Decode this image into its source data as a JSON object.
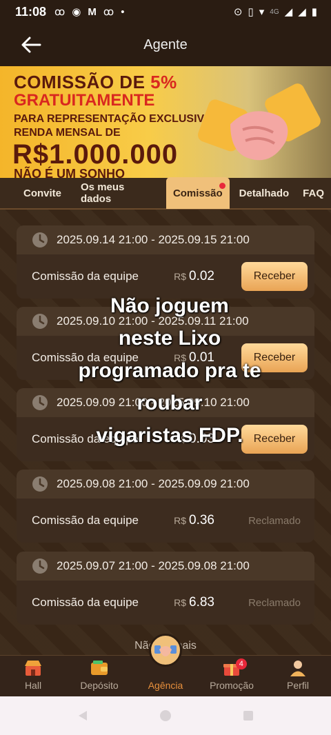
{
  "status_bar": {
    "time": "11:08",
    "notif_icons": [
      "sync-icon",
      "location-pin-icon",
      "gmail-icon",
      "sync-icon",
      "dot-icon"
    ],
    "network": "4G"
  },
  "header": {
    "title": "Agente"
  },
  "banner": {
    "line1_prefix": "COMISSÃO DE ",
    "line1_pct": "5%",
    "line2": "GRATUITAMENTE",
    "line3": "PARA REPRESENTAÇÃO EXCLUSIVA",
    "line4": "RENDA MENSAL DE",
    "line5": "R$1.000.000",
    "line6": "NÃO É UM SONHO"
  },
  "tabs": [
    {
      "label": "Convite",
      "active": false
    },
    {
      "label": "Os meus dados",
      "active": false
    },
    {
      "label": "Comissão",
      "active": true,
      "dot": true
    },
    {
      "label": "Detalhado",
      "active": false
    },
    {
      "label": "FAQ",
      "active": false
    }
  ],
  "records": [
    {
      "period": "2025.09.14 21:00 - 2025.09.15 21:00",
      "label": "Comissão da equipe",
      "currency": "R$",
      "amount": "0.02",
      "action": "Receber",
      "claimed": false
    },
    {
      "period": "2025.09.10 21:00 - 2025.09.11 21:00",
      "label": "Comissão da equipe",
      "currency": "R$",
      "amount": "0.01",
      "action": "Receber",
      "claimed": false
    },
    {
      "period": "2025.09.09 21:00 - 2025.09.10 21:00",
      "label": "Comissão da equipe",
      "currency": "R$",
      "amount": "0.03",
      "action": "Receber",
      "claimed": false
    },
    {
      "period": "2025.09.08 21:00 - 2025.09.09 21:00",
      "label": "Comissão da equipe",
      "currency": "R$",
      "amount": "0.36",
      "action": "Reclamado",
      "claimed": true
    },
    {
      "period": "2025.09.07 21:00 - 2025.09.08 21:00",
      "label": "Comissão da equipe",
      "currency": "R$",
      "amount": "6.83",
      "action": "Reclamado",
      "claimed": true
    }
  ],
  "list_footer": "Não há mais",
  "overlay_lines": [
    "Não joguem",
    "neste Lixo",
    "programado pra te",
    "roubar",
    "vigaristas FDP."
  ],
  "bottom_nav": [
    {
      "label": "Hall",
      "icon": "shop-icon"
    },
    {
      "label": "Depósito",
      "icon": "wallet-icon"
    },
    {
      "label": "Agência",
      "icon": "handshake-icon",
      "active": true
    },
    {
      "label": "Promoção",
      "icon": "gift-icon",
      "badge": "4"
    },
    {
      "label": "Perfil",
      "icon": "user-icon"
    }
  ],
  "colors": {
    "accent": "#e8903c",
    "tab_active": "#f0c07a",
    "button": "#f2b96a"
  }
}
